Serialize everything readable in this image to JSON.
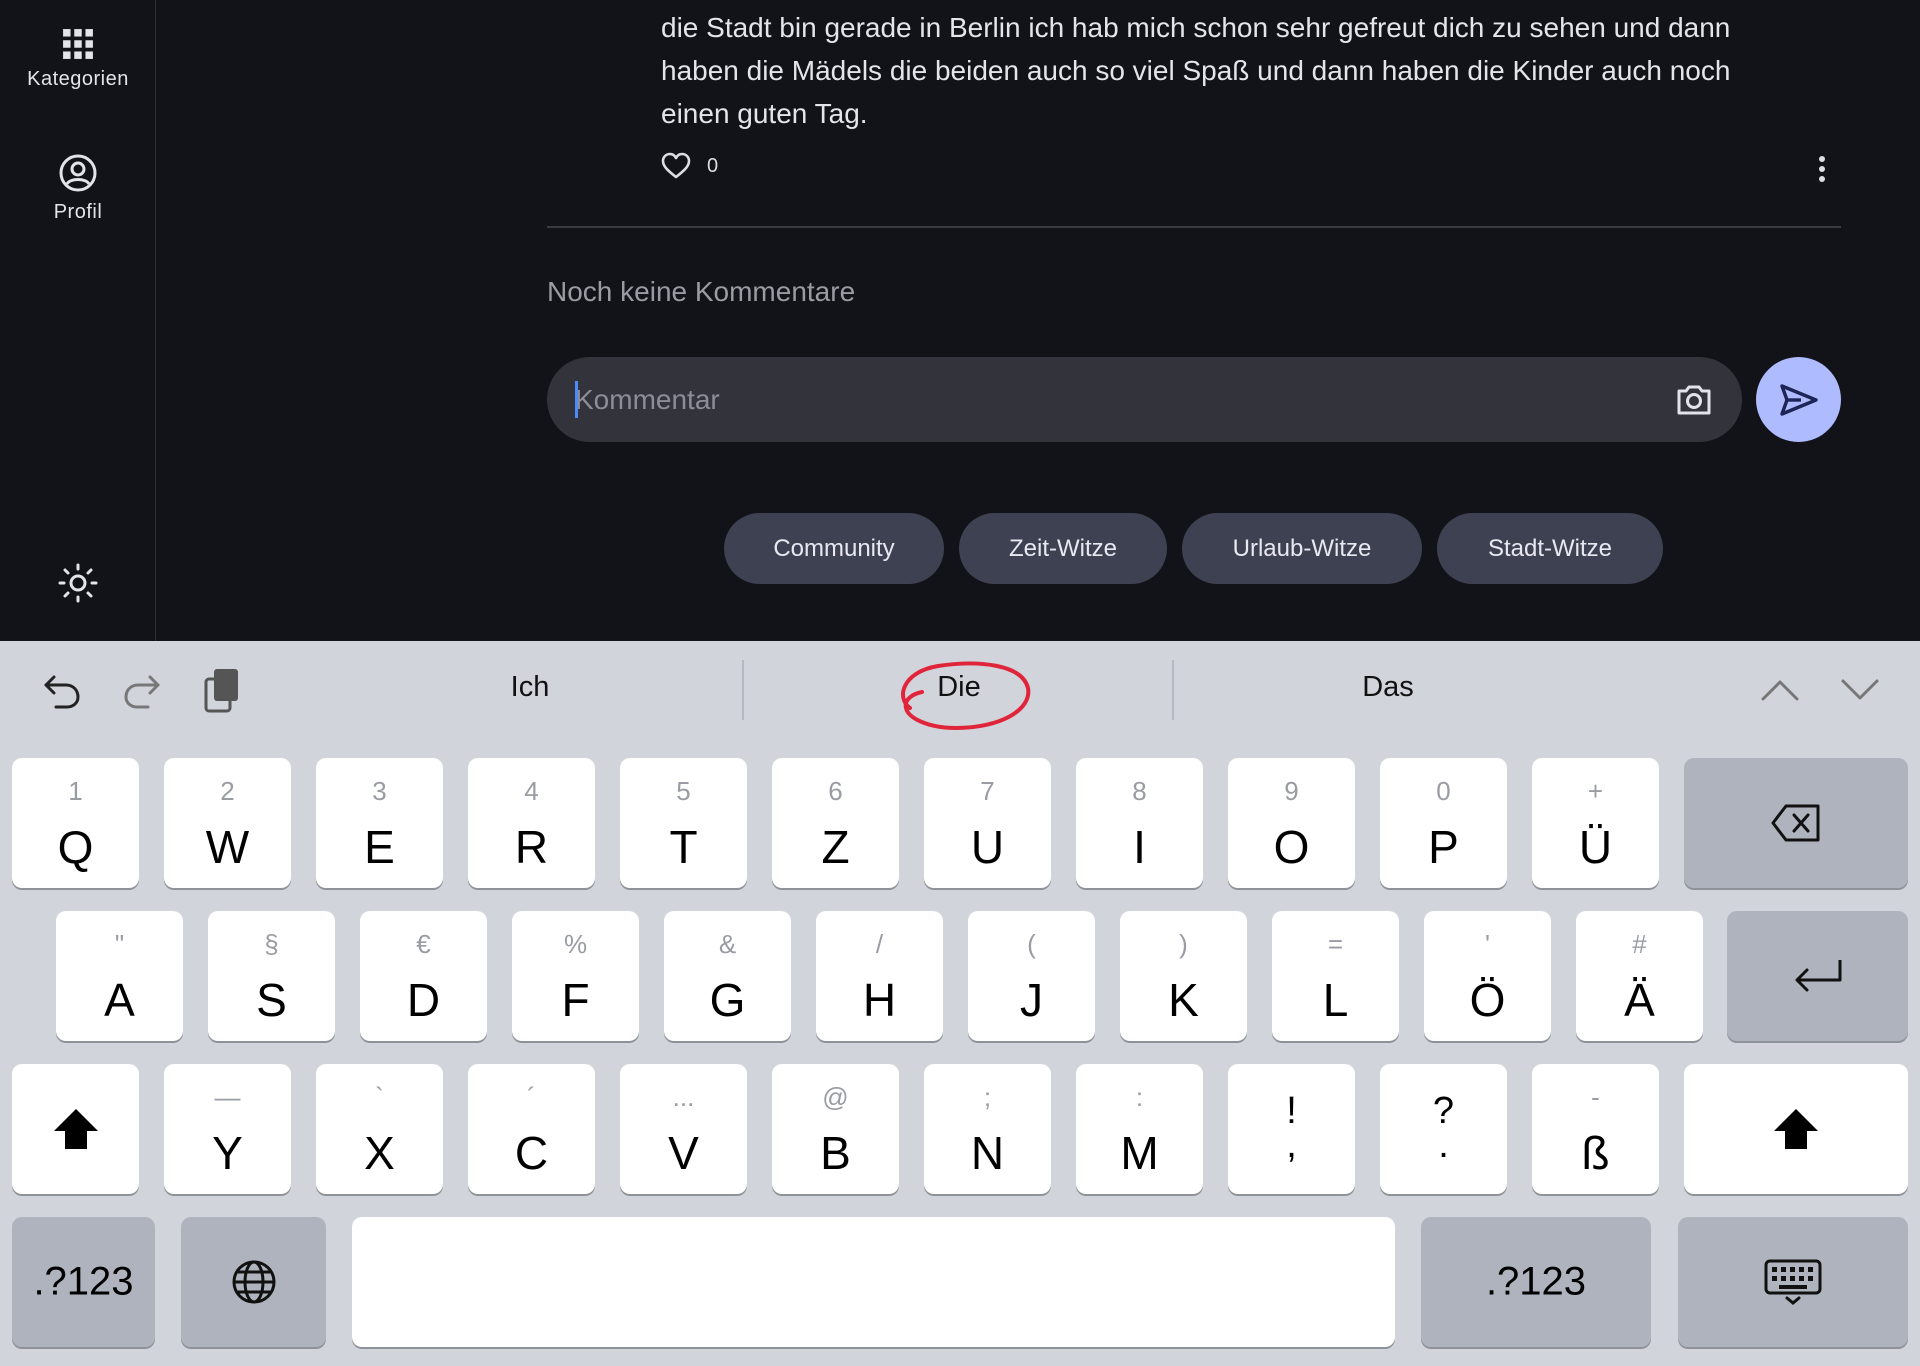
{
  "sidebar": {
    "categories_label": "Kategorien",
    "profile_label": "Profil"
  },
  "post": {
    "lines": [
      "die Stadt bin gerade in Berlin ich hab mich schon sehr gefreut dich zu sehen und dann",
      "haben die Mädels die beiden auch so viel Spaß und dann haben die Kinder auch noch",
      "einen guten Tag."
    ],
    "like_count": "0"
  },
  "comments": {
    "empty_text": "Noch keine Kommentare",
    "input_placeholder": "Kommentar"
  },
  "tags": [
    "Community",
    "Zeit-Witze",
    "Urlaub-Witze",
    "Stadt-Witze"
  ],
  "keyboard": {
    "suggestions": [
      "Ich",
      "Die",
      "Das"
    ],
    "highlight_color": "#e0253a",
    "rows": {
      "r1": [
        {
          "main": "Q",
          "sub": "1"
        },
        {
          "main": "W",
          "sub": "2"
        },
        {
          "main": "E",
          "sub": "3"
        },
        {
          "main": "R",
          "sub": "4"
        },
        {
          "main": "T",
          "sub": "5"
        },
        {
          "main": "Z",
          "sub": "6"
        },
        {
          "main": "U",
          "sub": "7"
        },
        {
          "main": "I",
          "sub": "8"
        },
        {
          "main": "O",
          "sub": "9"
        },
        {
          "main": "P",
          "sub": "0"
        },
        {
          "main": "Ü",
          "sub": "+"
        }
      ],
      "r2": [
        {
          "main": "A",
          "sub": "\""
        },
        {
          "main": "S",
          "sub": "§"
        },
        {
          "main": "D",
          "sub": "€"
        },
        {
          "main": "F",
          "sub": "%"
        },
        {
          "main": "G",
          "sub": "&"
        },
        {
          "main": "H",
          "sub": "/"
        },
        {
          "main": "J",
          "sub": "("
        },
        {
          "main": "K",
          "sub": ")"
        },
        {
          "main": "L",
          "sub": "="
        },
        {
          "main": "Ö",
          "sub": "'"
        },
        {
          "main": "Ä",
          "sub": "#"
        }
      ],
      "r3": [
        {
          "main": "Y",
          "sub": "—"
        },
        {
          "main": "X",
          "sub": "`"
        },
        {
          "main": "C",
          "sub": "´"
        },
        {
          "main": "V",
          "sub": "..."
        },
        {
          "main": "B",
          "sub": "@"
        },
        {
          "main": "N",
          "sub": ";"
        },
        {
          "main": "M",
          "sub": ":"
        }
      ],
      "punct": [
        {
          "top": "!",
          "bottom": ","
        },
        {
          "top": "?",
          "bottom": "."
        },
        {
          "main": "ß",
          "sub": "-"
        }
      ]
    },
    "numbers_label_left": ".?123",
    "numbers_label_right": ".?123"
  },
  "colors": {
    "background": "#121318",
    "send_button": "#aebbff",
    "chip": "#3d4152",
    "keyboard_bg": "#d1d4db"
  }
}
